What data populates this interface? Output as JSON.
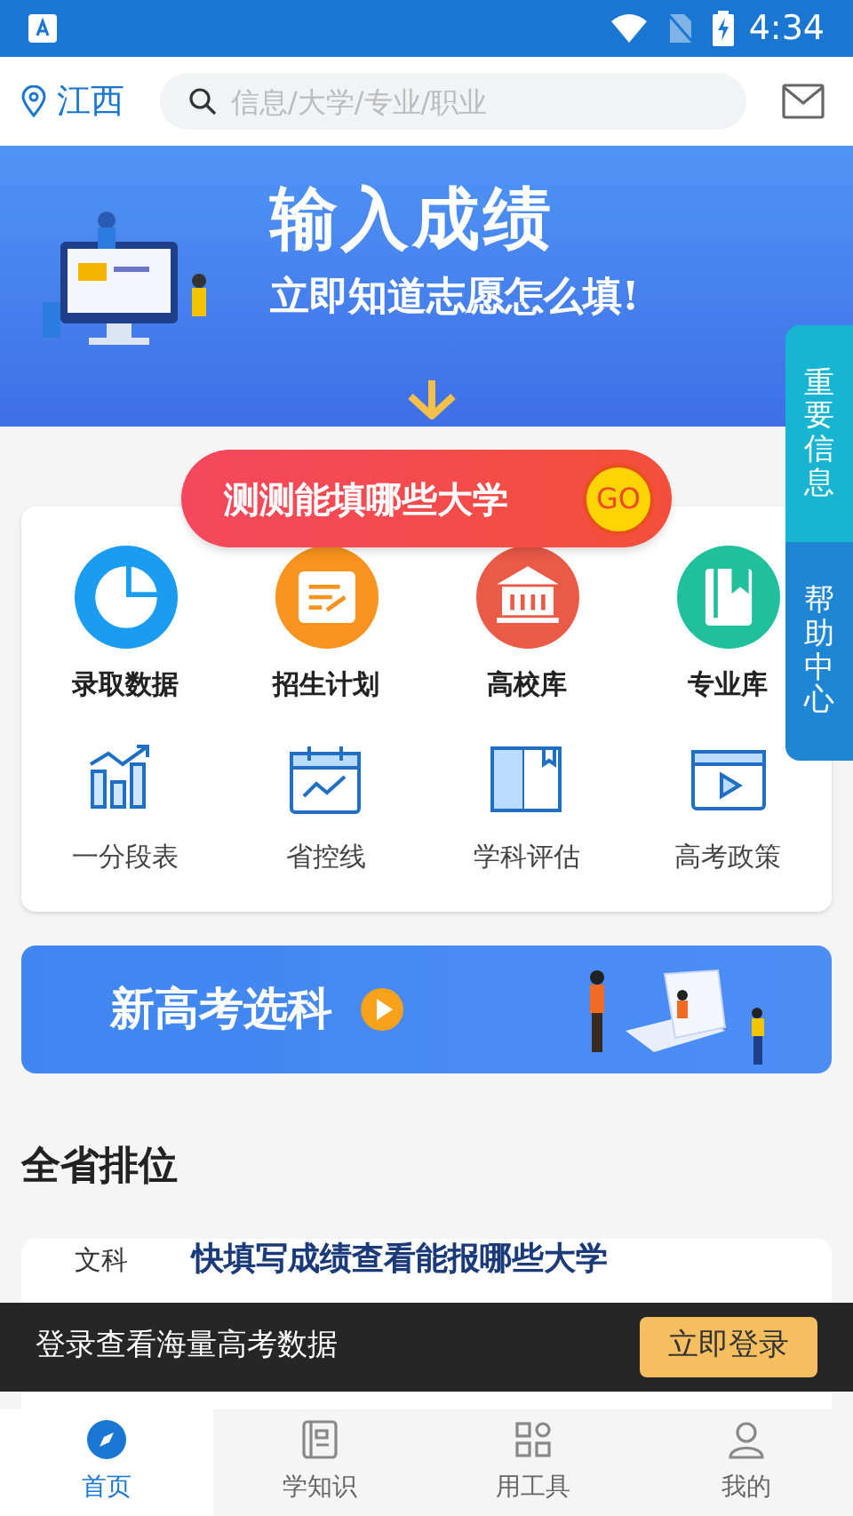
{
  "status_bar": {
    "time": "4:34"
  },
  "header": {
    "location": "江西",
    "search": {
      "placeholder": "信息/大学/专业/职业"
    }
  },
  "hero_banner": {
    "title": "输入成绩",
    "subtitle": "立即知道志愿怎么填!"
  },
  "cta_button": {
    "label": "测测能填哪些大学",
    "badge": "GO"
  },
  "side_tabs": [
    {
      "label": "重要信息",
      "kind": "info"
    },
    {
      "label": "帮助中心",
      "kind": "help"
    }
  ],
  "shortcuts": [
    {
      "label": "录取数据",
      "kind": "pie",
      "color": "#1a9cf0"
    },
    {
      "label": "招生计划",
      "kind": "plan",
      "color": "#f7931e"
    },
    {
      "label": "高校库",
      "kind": "school",
      "color": "#ea5a47"
    },
    {
      "label": "专业库",
      "kind": "book",
      "color": "#20c09c"
    }
  ],
  "tools": [
    {
      "label": "一分段表",
      "kind": "bars"
    },
    {
      "label": "省控线",
      "kind": "calendar"
    },
    {
      "label": "学科评估",
      "kind": "openbook"
    },
    {
      "label": "高考政策",
      "kind": "video"
    }
  ],
  "subject_banner": {
    "title": "新高考选科"
  },
  "ranking": {
    "title": "全省排位",
    "track": "文科",
    "prompt": "快填写成绩查看能报哪些大学"
  },
  "login_bar": {
    "text": "登录查看海量高考数据",
    "button": "立即登录"
  },
  "bottom_nav": [
    {
      "label": "首页",
      "kind": "compass",
      "selected": true
    },
    {
      "label": "学知识",
      "kind": "notebook",
      "selected": false
    },
    {
      "label": "用工具",
      "kind": "grid",
      "selected": false
    },
    {
      "label": "我的",
      "kind": "person",
      "selected": false
    }
  ]
}
